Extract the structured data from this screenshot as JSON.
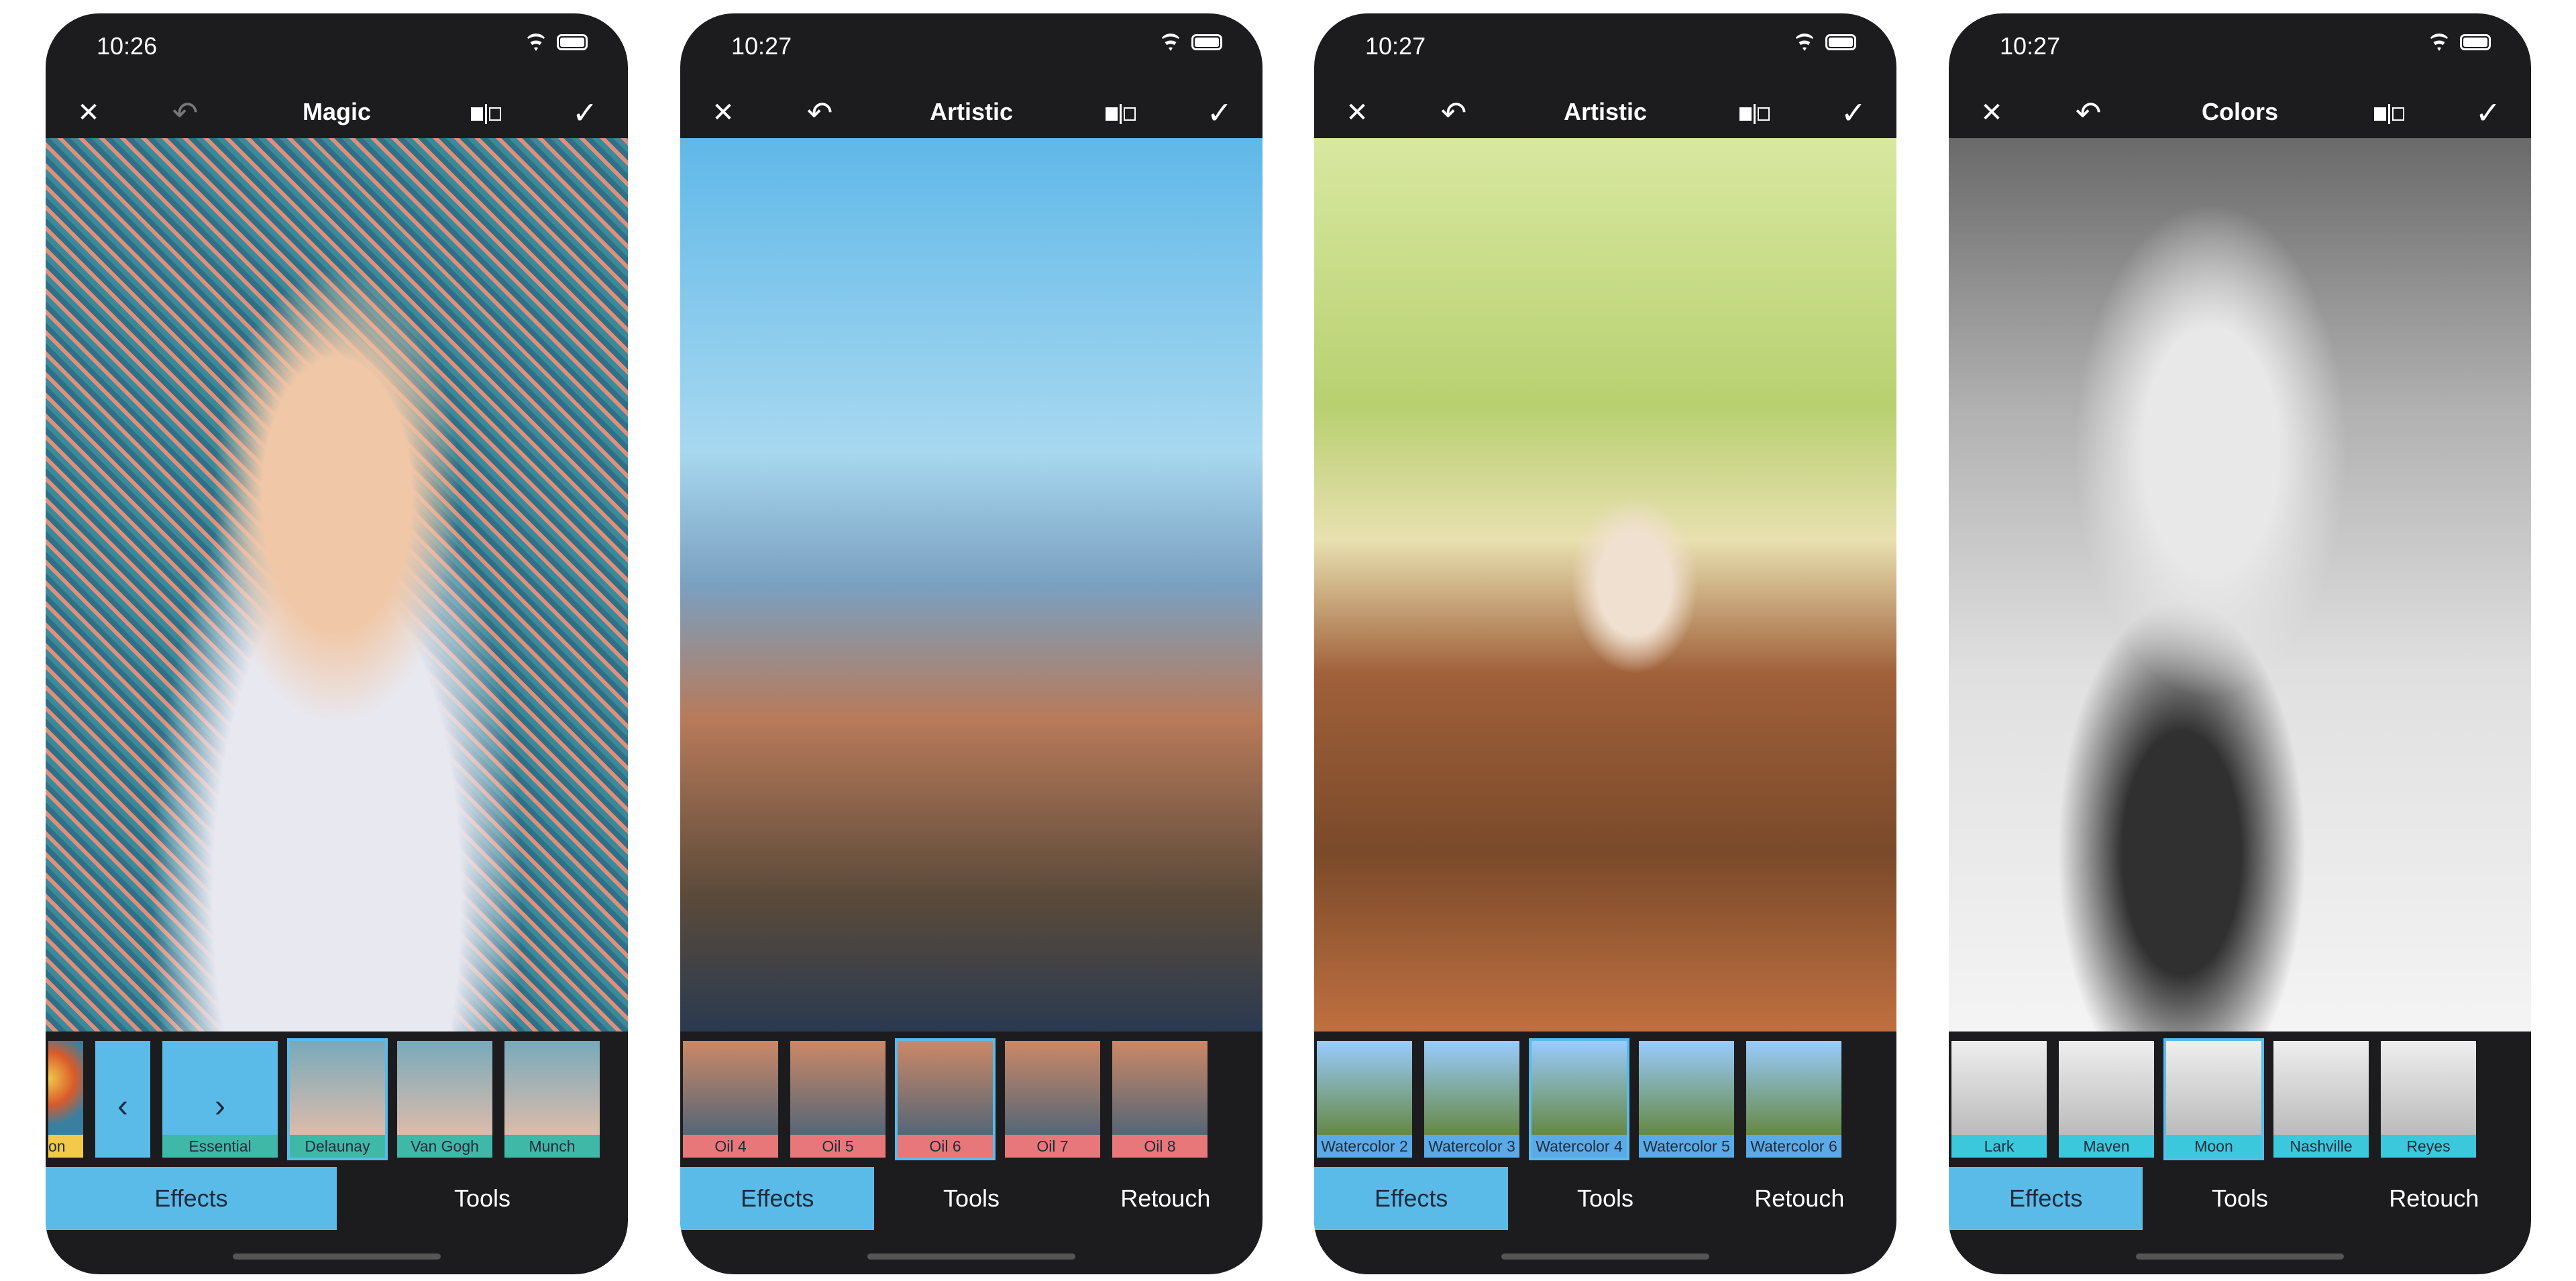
{
  "colors": {
    "accent": "#5bbbe8",
    "bar": "#1c1c1e"
  },
  "phones": [
    {
      "time": "10:26",
      "title": "Magic",
      "undo_enabled": false,
      "label_color": "#3fb8a8",
      "thumbs": [
        {
          "label": "on",
          "color": "#f3c94a",
          "partial": true
        },
        {
          "label": "",
          "arrow": "‹",
          "nav": true
        },
        {
          "label": "Essential",
          "arrow": "›",
          "nav": true
        },
        {
          "label": "Delaunay",
          "selected": true
        },
        {
          "label": "Van Gogh"
        },
        {
          "label": "Munch"
        }
      ],
      "tabs": [
        "Effects",
        "Tools"
      ]
    },
    {
      "time": "10:27",
      "title": "Artistic",
      "undo_enabled": true,
      "label_color": "#e8777a",
      "thumbs": [
        {
          "label": "Oil 4"
        },
        {
          "label": "Oil 5"
        },
        {
          "label": "Oil 6",
          "selected": true
        },
        {
          "label": "Oil 7"
        },
        {
          "label": "Oil 8"
        }
      ],
      "tabs": [
        "Effects",
        "Tools",
        "Retouch"
      ]
    },
    {
      "time": "10:27",
      "title": "Artistic",
      "undo_enabled": true,
      "label_color": "#5aaae8",
      "thumbs": [
        {
          "label": "Watercolor 2"
        },
        {
          "label": "Watercolor 3"
        },
        {
          "label": "Watercolor 4",
          "selected": true
        },
        {
          "label": "Watercolor 5"
        },
        {
          "label": "Watercolor 6"
        }
      ],
      "tabs": [
        "Effects",
        "Tools",
        "Retouch"
      ]
    },
    {
      "time": "10:27",
      "title": "Colors",
      "undo_enabled": true,
      "label_color": "#3cc8dc",
      "thumbs": [
        {
          "label": "Lark"
        },
        {
          "label": "Maven"
        },
        {
          "label": "Moon",
          "selected": true
        },
        {
          "label": "Nashville"
        },
        {
          "label": "Reyes"
        }
      ],
      "tabs": [
        "Effects",
        "Tools",
        "Retouch"
      ]
    }
  ],
  "icons": {
    "close": "close-icon",
    "undo": "undo-icon",
    "compare": "compare-icon",
    "apply": "checkmark-icon"
  }
}
